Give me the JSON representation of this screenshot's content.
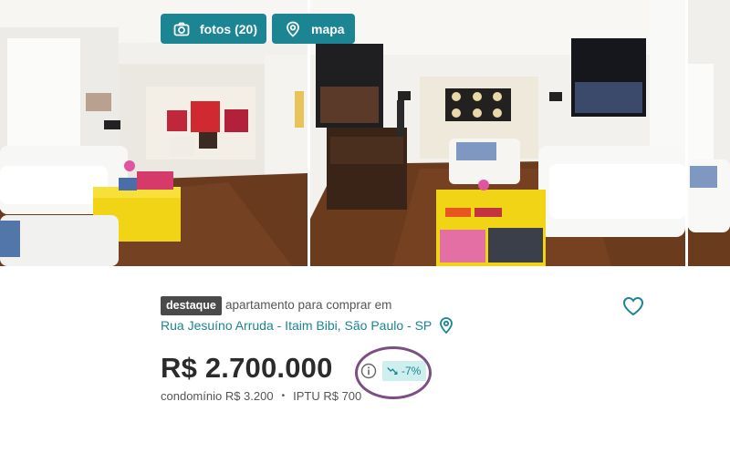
{
  "gallery": {
    "photos_button": {
      "label": "fotos (20)",
      "icon": "camera-icon"
    },
    "map_button": {
      "label": "mapa",
      "icon": "map-pin-icon"
    }
  },
  "listing": {
    "badge": "destaque",
    "type_text": "apartamento para comprar em",
    "address": "Rua Jesuíno Arruda - Itaim Bibi, São Paulo - SP",
    "price": "R$ 2.700.000",
    "discount": "-7%",
    "condo_fee": "condomínio R$ 3.200",
    "separator": "•",
    "iptu": "IPTU R$ 700"
  },
  "colors": {
    "accent": "#1b8594",
    "badge_bg": "#4a4a4a",
    "discount_bg": "#cfeeee",
    "annotation": "#7a4f84",
    "price_text": "#2b2b2b"
  }
}
